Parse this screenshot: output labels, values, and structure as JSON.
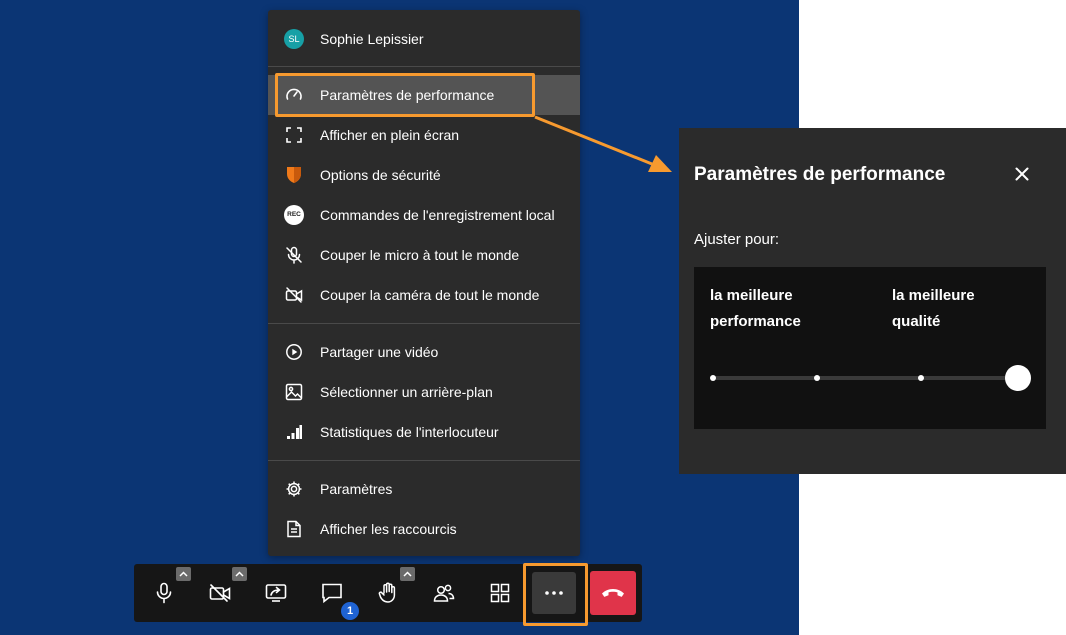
{
  "menu": {
    "user": {
      "initials": "SL",
      "name": "Sophie Lepissier"
    },
    "items": [
      {
        "label": "Paramètres de performance",
        "icon": "gauge-icon"
      },
      {
        "label": "Afficher en plein écran",
        "icon": "fullscreen-icon"
      },
      {
        "label": "Options de sécurité",
        "icon": "shield-icon"
      },
      {
        "label": "Commandes de l'enregistrement local",
        "icon": "rec-icon",
        "badge": "REC"
      },
      {
        "label": "Couper le micro à tout le monde",
        "icon": "mic-off-icon"
      },
      {
        "label": "Couper la caméra de tout le monde",
        "icon": "camera-off-icon"
      },
      {
        "label": "Partager une vidéo",
        "icon": "play-icon"
      },
      {
        "label": "Sélectionner un arrière-plan",
        "icon": "image-icon"
      },
      {
        "label": "Statistiques de l'interlocuteur",
        "icon": "stats-icon"
      },
      {
        "label": "Paramètres",
        "icon": "gear-icon"
      },
      {
        "label": "Afficher les raccourcis",
        "icon": "document-icon"
      }
    ]
  },
  "toolbar": {
    "participants_badge": "1"
  },
  "dialog": {
    "title": "Paramètres de performance",
    "adjust_label": "Ajuster pour:",
    "slider": {
      "left_label": "la meilleure performance",
      "right_label": "la meilleure qualité",
      "steps": 4,
      "selected_index": 3
    }
  },
  "colors": {
    "stage": "#0b3574",
    "panel": "#2b2b2b",
    "highlight": "#f79a2f",
    "hangup": "#e0344a",
    "avatar": "#17a0a6",
    "badge": "#1f63d3",
    "shield": "#f07a1a"
  }
}
